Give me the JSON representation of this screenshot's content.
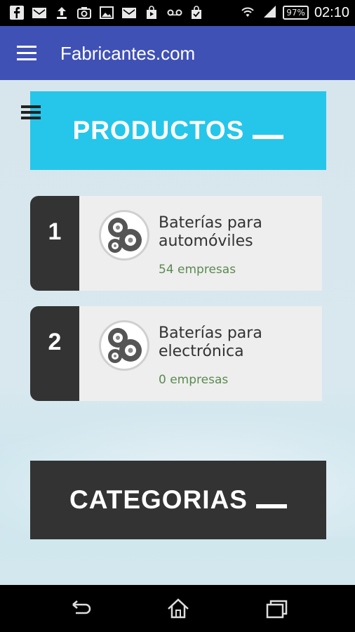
{
  "status_bar": {
    "battery": "97%",
    "time": "02:10",
    "icons": [
      "facebook-icon",
      "gmail-icon",
      "upload-icon",
      "camera-icon",
      "image-icon",
      "gmail-icon",
      "play-store-icon",
      "voicemail-icon",
      "shopping-bag-icon",
      "wifi-icon",
      "signal-icon",
      "battery-icon"
    ]
  },
  "app_bar": {
    "title": "Fabricantes.com"
  },
  "sections": {
    "productos": "PRODUCTOS",
    "categorias": "CATEGORIAS"
  },
  "products": [
    {
      "rank": "1",
      "name": "Baterías para automóviles",
      "count": "54 empresas"
    },
    {
      "rank": "2",
      "name": "Baterías para electrónica",
      "count": "0 empresas"
    }
  ],
  "colors": {
    "app_bar": "#3f51b5",
    "productos_header": "#26c6ea",
    "categorias_header": "#333333",
    "count_text": "#5b8a4f"
  }
}
